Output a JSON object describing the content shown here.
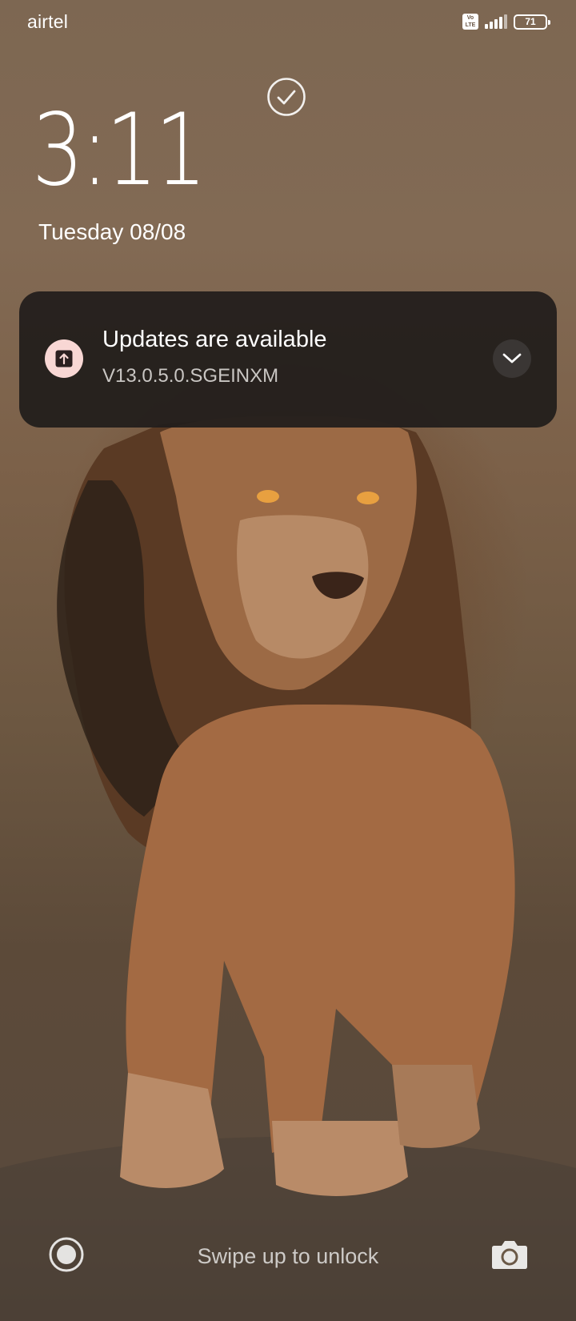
{
  "status_bar": {
    "carrier": "airtel",
    "volte_label": "Vo LTE",
    "battery_level": "71",
    "icons": [
      "volte-icon",
      "signal-icon",
      "battery-icon"
    ]
  },
  "lock_screen": {
    "time": "3:11",
    "date": "Tuesday 08/08",
    "status_icon": "check-circle-icon"
  },
  "notification": {
    "title": "Updates are available",
    "subtitle": "V13.0.5.0.SGEINXM",
    "app_icon": "upload-icon",
    "expand_icon": "chevron-down-icon",
    "icon_bg": "#f8d7d4",
    "card_bg": "#221e1c"
  },
  "bottom_bar": {
    "hint": "Swipe up to unlock",
    "left_icon": "circle-record-icon",
    "right_icon": "camera-icon"
  },
  "wallpaper": {
    "subject": "lion"
  }
}
